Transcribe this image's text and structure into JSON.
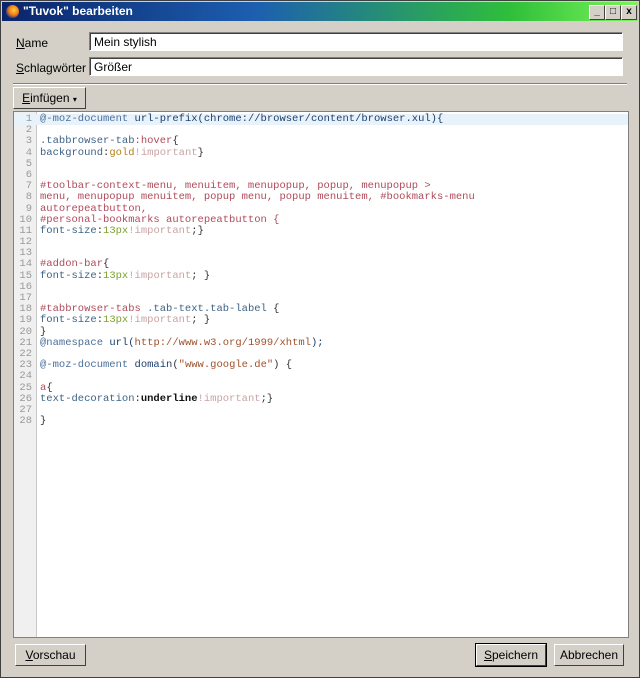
{
  "window": {
    "title": "\"Tuvok\" bearbeiten",
    "minimize": "_",
    "maximize": "□",
    "close": "x"
  },
  "form": {
    "name_label_accel": "N",
    "name_label_rest": "ame",
    "name_value": "Mein stylish",
    "tags_label_accel": "S",
    "tags_label_rest": "chlagwörter",
    "tags_value": "Größer"
  },
  "toolbar": {
    "insert_accel": "E",
    "insert_rest": "infügen",
    "insert_arrow": "▾"
  },
  "editor": {
    "active_line": 1,
    "lines": [
      [
        [
          "@-moz-document",
          "at"
        ],
        [
          " ",
          "plain"
        ],
        [
          "url-prefix",
          "fn"
        ],
        [
          "(chrome://browser/content/browser.xul){",
          "fn"
        ]
      ],
      [],
      [
        [
          ".tabbrowser-tab",
          "prop"
        ],
        [
          ":hover",
          "sel"
        ],
        [
          "{",
          "plain"
        ]
      ],
      [
        [
          "background",
          "prop"
        ],
        [
          ":",
          "plain"
        ],
        [
          "gold",
          "val"
        ],
        [
          "!important",
          "imp"
        ],
        [
          "}",
          "plain"
        ]
      ],
      [],
      [],
      [
        [
          "#toolbar-context-menu, menuitem, menupopup, popup, menupopup >",
          "sel"
        ]
      ],
      [
        [
          "menu, menupopup menuitem, popup menu, popup menuitem, #bookmarks-menu",
          "sel"
        ]
      ],
      [
        [
          "autorepeatbutton,",
          "sel"
        ]
      ],
      [
        [
          "#personal-bookmarks autorepeatbutton {",
          "sel"
        ]
      ],
      [
        [
          "font-size",
          "prop"
        ],
        [
          ":",
          "plain"
        ],
        [
          "13px",
          "num"
        ],
        [
          "!important",
          "imp"
        ],
        [
          ";}",
          "plain"
        ]
      ],
      [],
      [],
      [
        [
          "#addon-bar",
          "sel"
        ],
        [
          "{",
          "plain"
        ]
      ],
      [
        [
          "font-size",
          "prop"
        ],
        [
          ":",
          "plain"
        ],
        [
          "13px",
          "num"
        ],
        [
          "!important",
          "imp"
        ],
        [
          "; }",
          "plain"
        ]
      ],
      [],
      [],
      [
        [
          "#tabbrowser-tabs",
          "sel"
        ],
        [
          " .tab-text.tab-label",
          "prop"
        ],
        [
          " {",
          "plain"
        ]
      ],
      [
        [
          "font-size",
          "prop"
        ],
        [
          ":",
          "plain"
        ],
        [
          "13px",
          "num"
        ],
        [
          "!important",
          "imp"
        ],
        [
          "; }",
          "plain"
        ]
      ],
      [
        [
          "}",
          "plain"
        ]
      ],
      [
        [
          "@namespace",
          "at"
        ],
        [
          " ",
          "plain"
        ],
        [
          "url(",
          "fn"
        ],
        [
          "http://www.w3.org/1999/xhtml",
          "str"
        ],
        [
          ");",
          "fn"
        ]
      ],
      [],
      [
        [
          "@-moz-document",
          "at"
        ],
        [
          " ",
          "plain"
        ],
        [
          "domain",
          "fn"
        ],
        [
          "(",
          "plain"
        ],
        [
          "\"www.google.de\"",
          "str"
        ],
        [
          ") {",
          "plain"
        ]
      ],
      [],
      [
        [
          "a",
          "sel"
        ],
        [
          "{",
          "plain"
        ]
      ],
      [
        [
          "text-decoration",
          "prop"
        ],
        [
          ":",
          "plain"
        ],
        [
          "underline",
          "kw"
        ],
        [
          "!important",
          "imp"
        ],
        [
          ";}",
          "plain"
        ]
      ],
      [],
      [
        [
          "}",
          "plain"
        ]
      ]
    ]
  },
  "footer": {
    "preview_accel": "V",
    "preview_rest": "orschau",
    "save_accel": "S",
    "save_rest": "peichern",
    "cancel_label": "Abbrechen"
  }
}
